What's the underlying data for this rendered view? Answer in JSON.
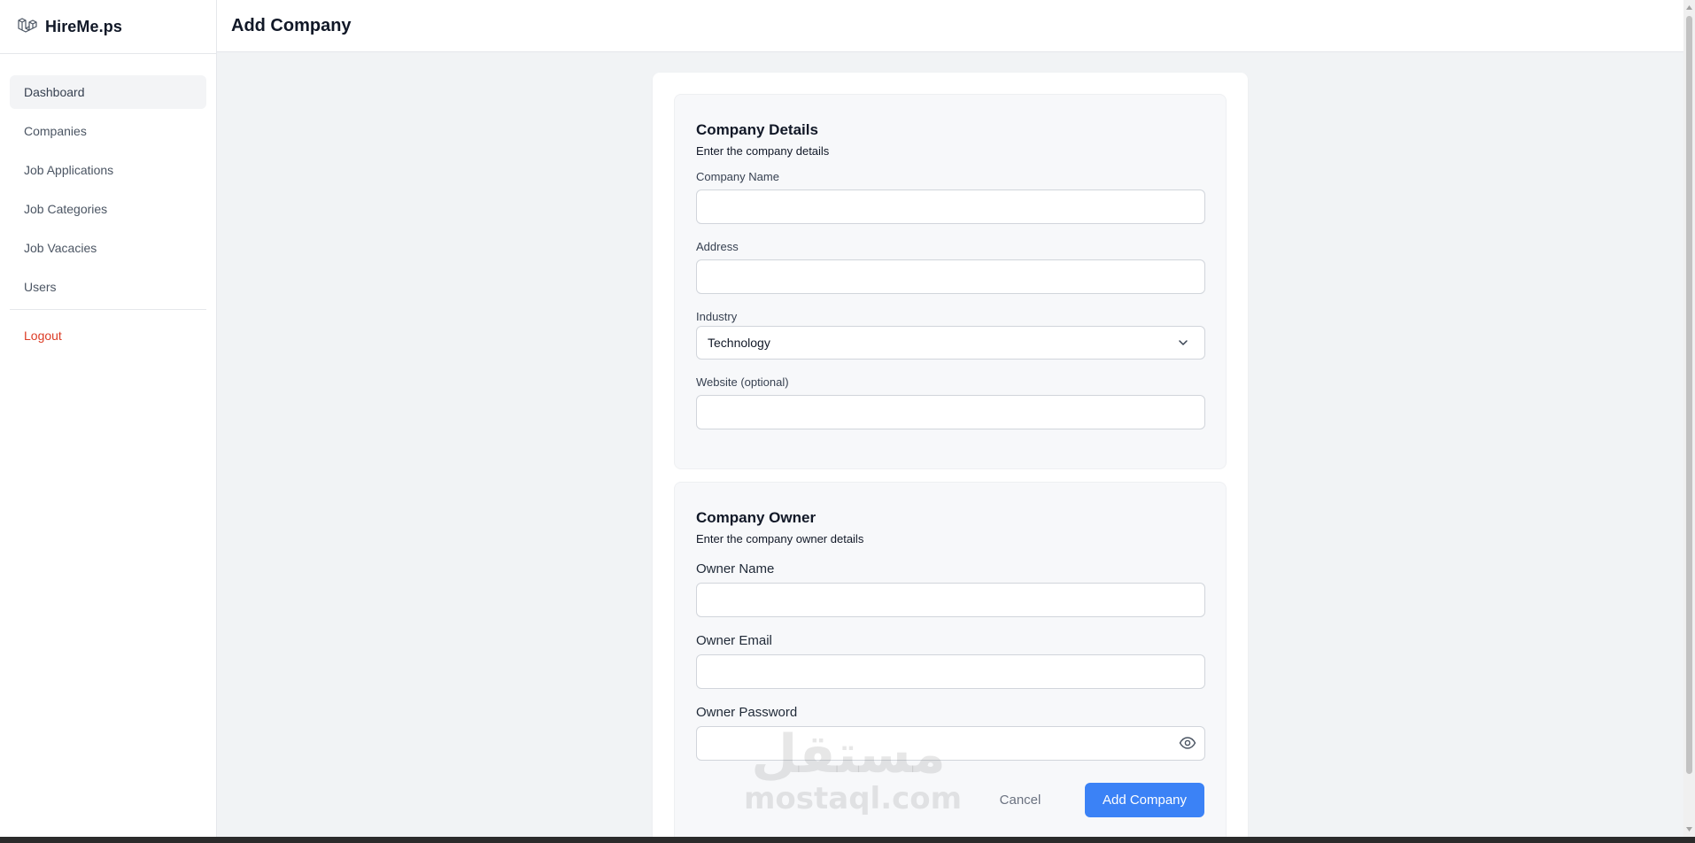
{
  "app": {
    "brand_name": "HireMe.ps"
  },
  "sidebar": {
    "items": [
      {
        "label": "Dashboard",
        "active": true
      },
      {
        "label": "Companies"
      },
      {
        "label": "Job Applications"
      },
      {
        "label": "Job Categories"
      },
      {
        "label": "Job Vacacies"
      },
      {
        "label": "Users"
      }
    ],
    "logout_label": "Logout"
  },
  "header": {
    "title": "Add Company"
  },
  "company_details": {
    "title": "Company Details",
    "subtitle": "Enter the company details",
    "company_name": {
      "label": "Company Name",
      "value": "",
      "placeholder": ""
    },
    "address": {
      "label": "Address",
      "value": "",
      "placeholder": ""
    },
    "industry": {
      "label": "Industry",
      "selected": "Technology"
    },
    "website": {
      "label": "Website (optional)",
      "value": "",
      "placeholder": ""
    }
  },
  "company_owner": {
    "title": "Company Owner",
    "subtitle": "Enter the company owner details",
    "owner_name": {
      "label": "Owner Name",
      "value": "",
      "placeholder": ""
    },
    "owner_email": {
      "label": "Owner Email",
      "value": "",
      "placeholder": ""
    },
    "owner_password": {
      "label": "Owner Password",
      "value": "",
      "placeholder": ""
    }
  },
  "actions": {
    "cancel_label": "Cancel",
    "submit_label": "Add Company"
  },
  "watermark": {
    "arabic": "مستقل",
    "latin": "mostaql.com"
  },
  "colors": {
    "primary": "#3b82f6",
    "logout": "#dc3c26",
    "background": "#f1f3f5"
  },
  "icons": {
    "brand": "laravel-logo-icon",
    "select": "chevron-down-icon",
    "password": "eye-icon"
  }
}
